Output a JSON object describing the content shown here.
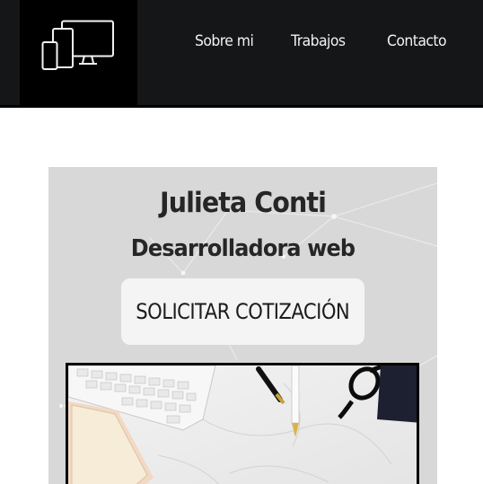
{
  "nav": {
    "logo_icon": "devices-icon",
    "links": [
      {
        "label": "Sobre mi"
      },
      {
        "label": "Trabajos"
      },
      {
        "label": "Contacto"
      }
    ]
  },
  "hero": {
    "name": "Julieta Conti",
    "role": "Desarrolladora web",
    "cta_label": "SOLICITAR COTIZACIÓN",
    "image_icon": "desk-workspace-photo"
  },
  "colors": {
    "navbar": "#151617",
    "logo_bg": "#000000",
    "hero_bg": "#d8d8d8",
    "button_bg": "#f4f4f4",
    "text": "#262626"
  }
}
